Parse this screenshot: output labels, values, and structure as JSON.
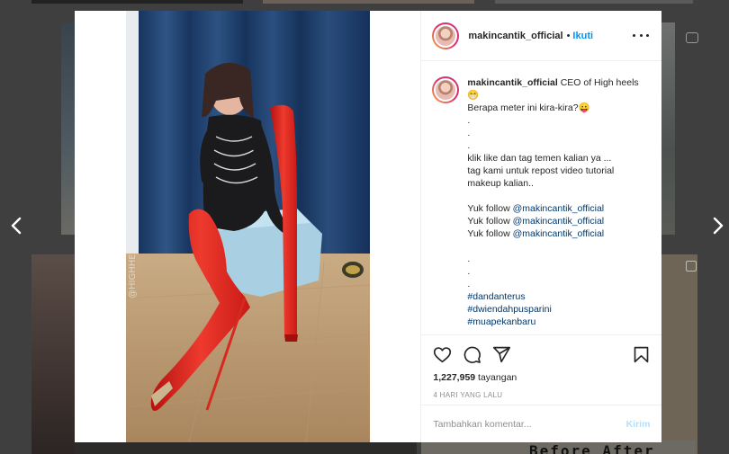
{
  "post": {
    "username": "makincantik_official",
    "follow_label": "Ikuti",
    "separator": "•"
  },
  "caption": {
    "username": "makincantik_official",
    "lines": [
      "CEO of High heels😁",
      "Berapa meter ini kira-kira?😛",
      ".",
      ".",
      ".",
      "klik like dan tag temen kalian ya ...",
      "tag kami untuk repost video tutorial makeup kalian..",
      "",
      "Yuk follow ",
      "Yuk follow ",
      "Yuk follow ",
      "",
      ".",
      ".",
      ".",
      "#dandanterus",
      "#dwiendahpusparini",
      "#muapekanbaru"
    ],
    "mention": "@makincantik_official"
  },
  "stats": {
    "views_count": "1,227,959",
    "views_label": "tayangan",
    "date": "4 HARI YANG LALU"
  },
  "comment_box": {
    "placeholder": "Tambahkan komentar...",
    "post_label": "Kirim"
  },
  "background": {
    "tile_text": "Before     After"
  },
  "colors": {
    "link_blue": "#0095f6",
    "boot_red": "#e3231f",
    "curtain_blue": "#1f3d6b"
  }
}
